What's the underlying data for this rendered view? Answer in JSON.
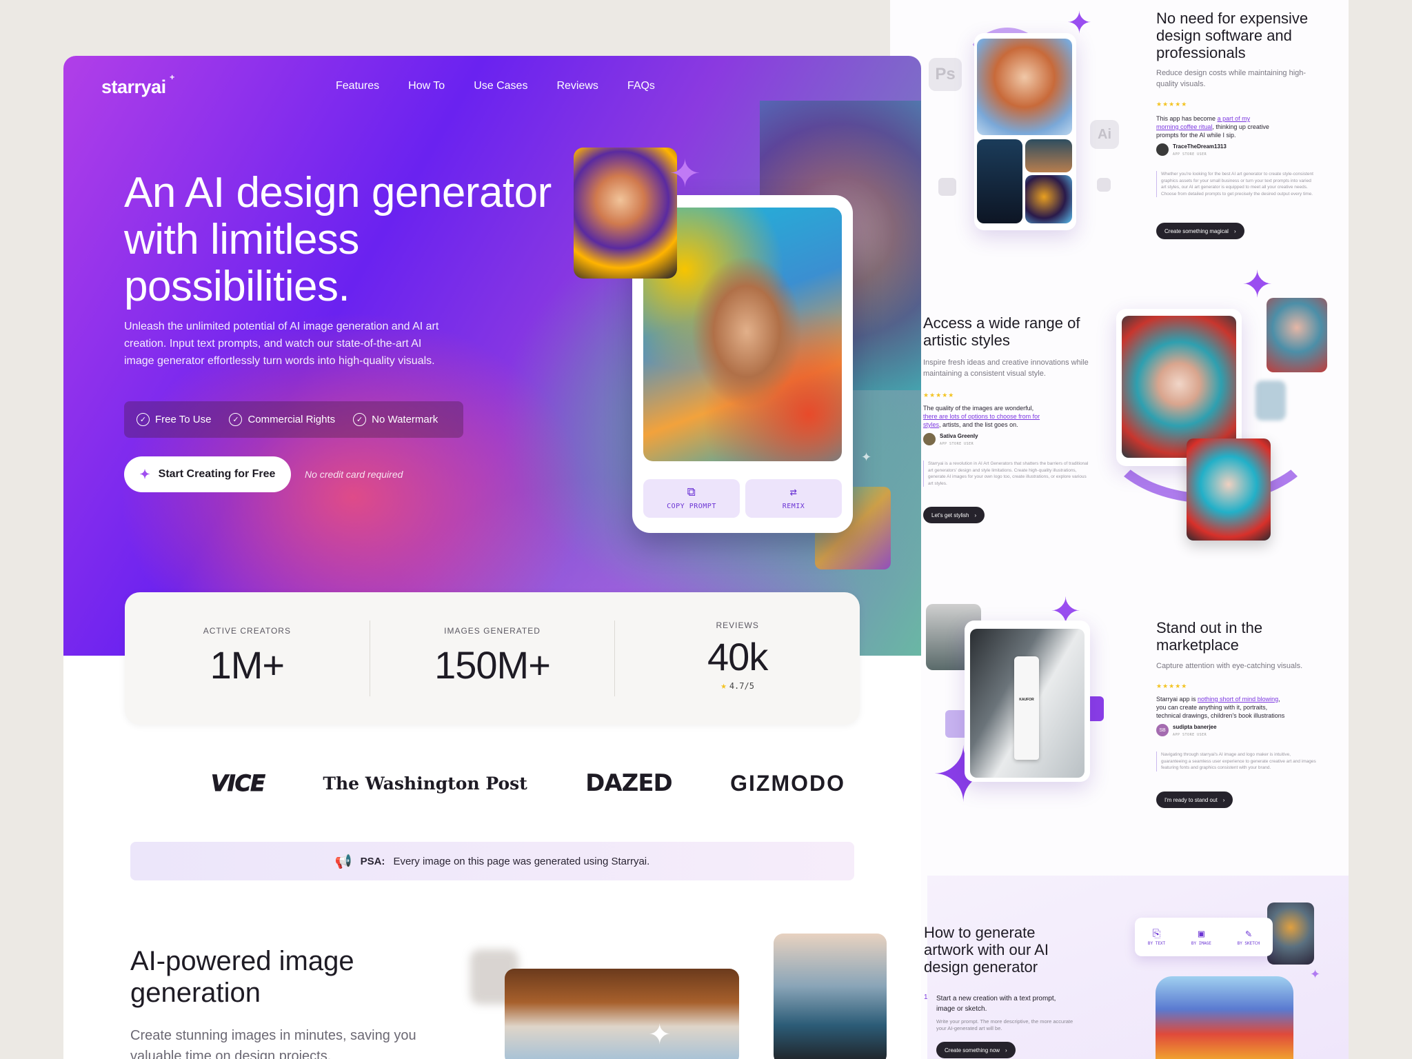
{
  "brand": {
    "name": "starryai",
    "spark": "+"
  },
  "nav": [
    "Features",
    "How To",
    "Use Cases",
    "Reviews",
    "FAQs"
  ],
  "hero": {
    "title": "An AI design generator with limitless possibilities.",
    "subtitle": "Unleash the unlimited potential of AI image generation and AI art creation. Input text prompts, and watch our state-of-the-art AI image generator effortlessly turn words into high-quality visuals.",
    "badges": [
      "Free To Use",
      "Commercial Rights",
      "No Watermark"
    ],
    "cta": "Start Creating for Free",
    "cta_note": "No credit card required"
  },
  "phone_card": {
    "copy_prompt": "COPY PROMPT",
    "remix": "REMIX"
  },
  "stats": [
    {
      "label": "ACTIVE CREATORS",
      "value": "1M+"
    },
    {
      "label": "IMAGES GENERATED",
      "value": "150M+"
    },
    {
      "label": "REVIEWS",
      "value": "40k",
      "rating": "4.7/5"
    }
  ],
  "press": [
    "VICE",
    "The Washington Post",
    "DAZED",
    "GIZMODO"
  ],
  "psa": {
    "label": "PSA:",
    "text": "Every image on this page was generated using Starryai."
  },
  "section_ai": {
    "title": "AI-powered image generation",
    "subtitle": "Create stunning images in minutes, saving you valuable time on design projects."
  },
  "side": {
    "sec1": {
      "title": "No need for expensive design software and professionals",
      "desc": "Reduce design costs while maintaining high-quality visuals.",
      "stars": "★★★★★",
      "quote_a": "This app has become ",
      "quote_hl": "a part of my morning coffee ritual",
      "quote_b": ", thinking up creative prompts for the AI while I sip.",
      "reviewer": "TraceTheDream1313",
      "role": "APP STORE USER",
      "blurb": "Whether you're looking for the best AI art generator to create style-consistent graphics assets for your small business or turn your text prompts into varied art styles, our AI art generator is equipped to meet all your creative needs. Choose from detailed prompts to get precisely the desired output every time.",
      "button": "Create something magical",
      "tiles": [
        "Ps",
        "Ai"
      ]
    },
    "sec2": {
      "title": "Access a wide range of artistic styles",
      "desc": "Inspire fresh ideas and creative innovations while maintaining a consistent visual style.",
      "stars": "★★★★★",
      "quote_a": "The quality of the images are wonderful, ",
      "quote_hl": "there are lots of options to choose from for styles",
      "quote_b": ", artists, and the list goes on.",
      "reviewer": "Sativa Greenly",
      "role": "APP STORE USER",
      "blurb": "Starryai is a revolution in AI Art Generators that shatters the barriers of traditional art generators' design and style limitations. Create high-quality illustrations, generate AI images for your own logo too, create illustrations, or explore various art styles.",
      "button": "Let's get stylish"
    },
    "sec3": {
      "title": "Stand out in the marketplace",
      "desc": "Capture attention with eye-catching visuals.",
      "stars": "★★★★★",
      "quote_a": "Starryai app is ",
      "quote_hl": "nothing short of mind blowing",
      "quote_b": ", you can create anything with it, portraits, technical drawings, children's book illustrations",
      "reviewer": "sudipta banerjee",
      "avatar": "SB",
      "role": "APP STORE USER",
      "blurb": "Navigating through starryai's AI image and logo maker is intuitive, guaranteeing a seamless user experience to generate creative art and images featuring fonts and graphics consistent with your brand.",
      "button": "I'm ready to stand out",
      "product_label": "KAUFOR"
    },
    "sec4": {
      "title": "How to generate artwork with our AI design generator",
      "step_num": "1",
      "step_title": "Start a new creation with a text prompt, image or sketch.",
      "step_desc": "Write your prompt. The more descriptive, the more accurate your AI-generated art will be.",
      "button": "Create something now",
      "tools": [
        "BY TEXT",
        "BY IMAGE",
        "BY SKETCH"
      ]
    }
  },
  "colors": {
    "accent": "#6b34d4",
    "hero_start": "#b13fe8",
    "hero_mid": "#6a22f0",
    "hero_green": "#6ab7a4",
    "star": "#f3c322"
  }
}
